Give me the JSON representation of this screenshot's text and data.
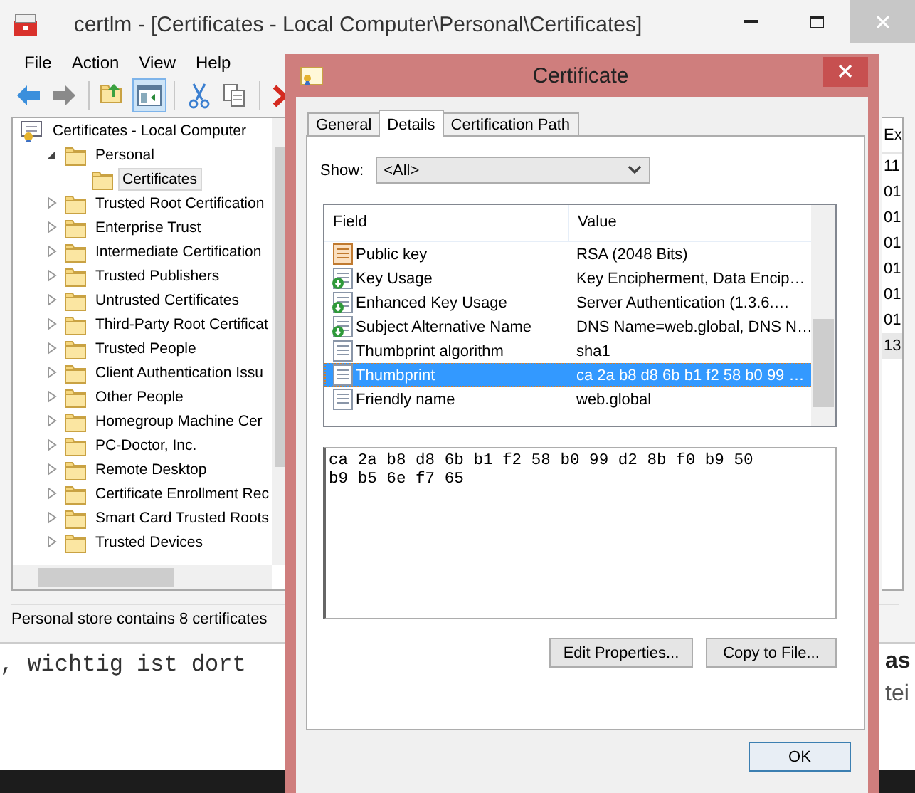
{
  "main_window": {
    "title": "certlm - [Certificates - Local Computer\\Personal\\Certificates]",
    "menu": [
      "File",
      "Action",
      "View",
      "Help"
    ],
    "tree": {
      "label": "Certificates - Local Computer",
      "selected": false,
      "children": [
        {
          "label": "Personal",
          "selected": false,
          "expanded": true,
          "children": [
            {
              "label": "Certificates",
              "selected": true
            }
          ]
        },
        {
          "label": "Trusted Root Certification",
          "selected": false,
          "expanded": false
        },
        {
          "label": "Enterprise Trust",
          "selected": false,
          "expanded": false
        },
        {
          "label": "Intermediate Certification",
          "selected": false,
          "expanded": false
        },
        {
          "label": "Trusted Publishers",
          "selected": false,
          "expanded": false
        },
        {
          "label": "Untrusted Certificates",
          "selected": false,
          "expanded": false
        },
        {
          "label": "Third-Party Root Certificat",
          "selected": false,
          "expanded": false
        },
        {
          "label": "Trusted People",
          "selected": false,
          "expanded": false
        },
        {
          "label": "Client Authentication Issu",
          "selected": false,
          "expanded": false
        },
        {
          "label": "Other People",
          "selected": false,
          "expanded": false
        },
        {
          "label": "Homegroup Machine Cer",
          "selected": false,
          "expanded": false
        },
        {
          "label": "PC-Doctor, Inc.",
          "selected": false,
          "expanded": false
        },
        {
          "label": "Remote Desktop",
          "selected": false,
          "expanded": false
        },
        {
          "label": "Certificate Enrollment Rec",
          "selected": false,
          "expanded": false
        },
        {
          "label": "Smart Card Trusted Roots",
          "selected": false,
          "expanded": false
        },
        {
          "label": "Trusted Devices",
          "selected": false,
          "expanded": false
        }
      ]
    },
    "list_column": "Ex",
    "list_cells": [
      {
        "text": "11",
        "selected": false
      },
      {
        "text": "01",
        "selected": false
      },
      {
        "text": "01",
        "selected": false
      },
      {
        "text": "01",
        "selected": false
      },
      {
        "text": "01",
        "selected": false
      },
      {
        "text": "01",
        "selected": false
      },
      {
        "text": "01",
        "selected": false
      },
      {
        "text": "13",
        "selected": true
      }
    ],
    "status_bar": "Personal store contains 8 certificates"
  },
  "background_page": {
    "code_text": ", wichtig ist dort",
    "heading": "as",
    "line": "tei"
  },
  "dialog": {
    "title": "Certificate",
    "tabs": [
      {
        "label": "General",
        "selected": false
      },
      {
        "label": "Details",
        "selected": true
      },
      {
        "label": "Certification Path",
        "selected": false
      }
    ],
    "show_label": "Show:",
    "show_value": "<All>",
    "columns": [
      "Field",
      "Value"
    ],
    "rows": [
      {
        "kind": "key",
        "field": "Public key",
        "value": "RSA (2048 Bits)",
        "selected": false
      },
      {
        "kind": "extension",
        "field": "Key Usage",
        "value": "Key Encipherment, Data Encip…",
        "selected": false
      },
      {
        "kind": "extension",
        "field": "Enhanced Key Usage",
        "value": "Server Authentication (1.3.6.…",
        "selected": false
      },
      {
        "kind": "extension",
        "field": "Subject Alternative Name",
        "value": "DNS Name=web.global, DNS N…",
        "selected": false
      },
      {
        "kind": "property",
        "field": "Thumbprint algorithm",
        "value": "sha1",
        "selected": false
      },
      {
        "kind": "property",
        "field": "Thumbprint",
        "value": "ca 2a b8 d8 6b b1 f2 58 b0 99 …",
        "selected": true
      },
      {
        "kind": "property",
        "field": "Friendly name",
        "value": "web.global",
        "selected": false
      }
    ],
    "detail_text": "ca 2a b8 d8 6b b1 f2 58 b0 99 d2 8b f0 b9 50\nb9 b5 6e f7 65",
    "buttons": [
      "Edit Properties...",
      "Copy to File..."
    ],
    "ok": "OK"
  }
}
